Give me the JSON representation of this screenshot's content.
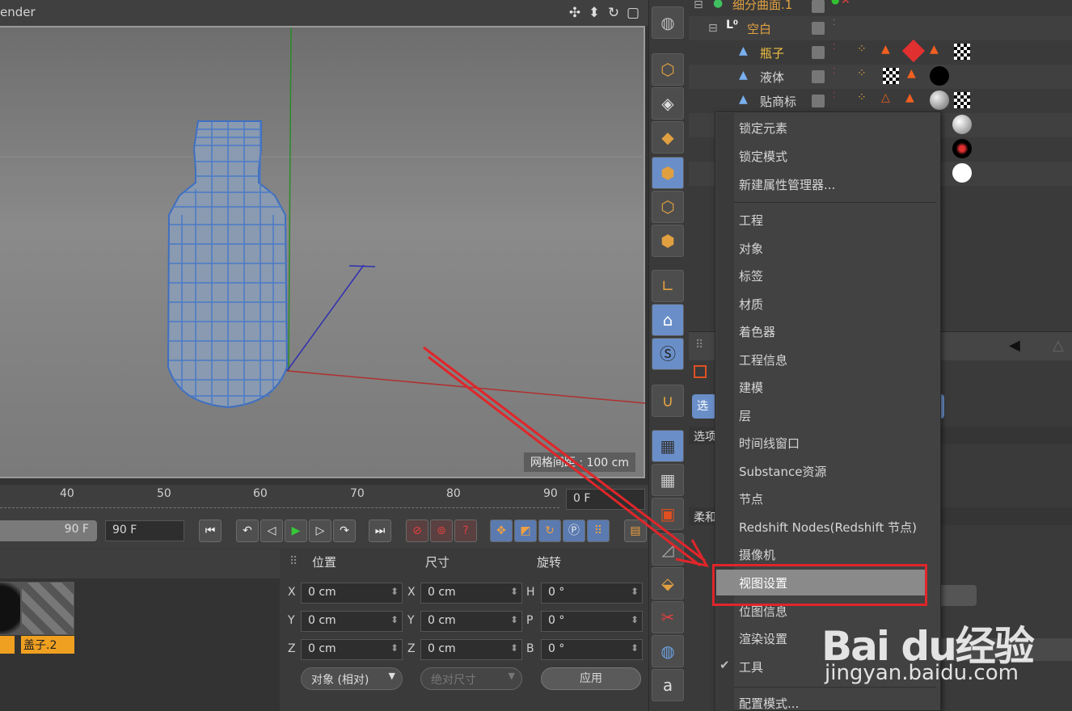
{
  "viewport": {
    "title": "ender",
    "grid_spacing": "网格间距 : 100 cm"
  },
  "timeline": {
    "ticks": [
      "40",
      "50",
      "60",
      "70",
      "80",
      "90"
    ],
    "current_frame": "0 F",
    "range_end": "90 F",
    "range_field": "90 F"
  },
  "materials": {
    "items": [
      {
        "label": ""
      },
      {
        "label": "盖子.2"
      }
    ]
  },
  "coordinates": {
    "headers": {
      "position": "位置",
      "size": "尺寸",
      "rotation": "旋转"
    },
    "rows": [
      {
        "axis_p": "X",
        "pos": "0 cm",
        "axis_s": "X",
        "size": "0 cm",
        "axis_r": "H",
        "rot": "0 °"
      },
      {
        "axis_p": "Y",
        "pos": "0 cm",
        "axis_s": "Y",
        "size": "0 cm",
        "axis_r": "P",
        "rot": "0 °"
      },
      {
        "axis_p": "Z",
        "pos": "0 cm",
        "axis_s": "Z",
        "size": "0 cm",
        "axis_r": "B",
        "rot": "0 °"
      }
    ],
    "mode_dropdown": "对象 (相对)",
    "size_dropdown": "绝对尺寸",
    "apply": "应用"
  },
  "objects": {
    "rows": [
      {
        "name": "细分曲面.1",
        "color": "#e0a040"
      },
      {
        "name": "空白",
        "color": "#e0a040"
      },
      {
        "name": "瓶子",
        "color": "#f0c040"
      },
      {
        "name": "液体",
        "color": "#d8d8d8"
      },
      {
        "name": "贴商标",
        "color": "#d8d8d8"
      }
    ]
  },
  "attributes": {
    "tab_partial_1": "选",
    "section_1": "选项",
    "section_2": "柔和"
  },
  "context_menu": {
    "group1": [
      "锁定元素",
      "锁定模式",
      "新建属性管理器..."
    ],
    "group2": [
      "工程",
      "对象",
      "标签",
      "材质",
      "着色器",
      "工程信息",
      "建模",
      "层",
      "时间线窗口",
      "Substance资源",
      "节点",
      "Redshift Nodes(Redshift 节点)",
      "摄像机",
      "视图设置",
      "位图信息",
      "渲染设置",
      "工具"
    ],
    "group3": [
      "配置模式..."
    ],
    "highlighted": "视图设置",
    "checked": "工具"
  },
  "watermark": {
    "main": "Bai du经验",
    "sub": "jingyan.baidu.com"
  },
  "colors": {
    "accent_orange": "#e0a040",
    "annotation_red": "#e0262a",
    "highlight_blue": "#6a8fc8"
  }
}
